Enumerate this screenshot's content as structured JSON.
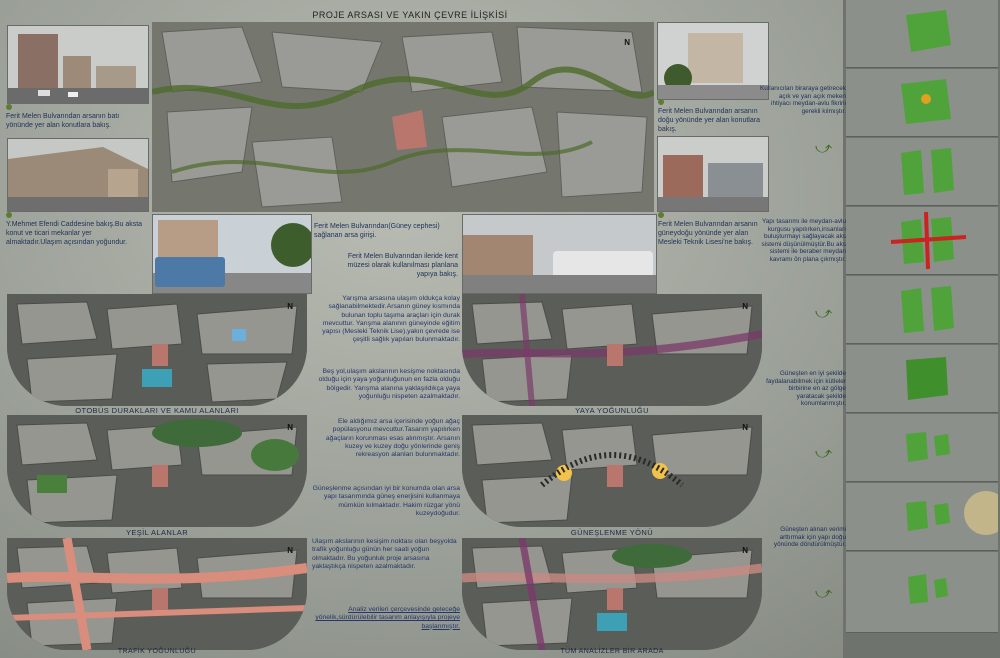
{
  "page_title": "PROJE ARSASI VE YAKIN ÇEVRE İLİŞKİSİ",
  "north": "N",
  "captions": {
    "c1": "Ferit Melen Bulvarından arsanın batı yönünde yer alan konutlara bakış.",
    "c2": "Y.Mehmet Efendi Caddesine bakış.Bu aksta konut ve ticari mekanlar yer almaktadır.Ulaşım açısından yoğundur.",
    "c3": "Ferit Melen Bulvarından arsanın doğu yönünde yer alan konutlara bakış.",
    "c4": "Ferit Melen Bulvarından(Güney cephesi) sağlanan arsa girişi.",
    "c5": "Ferit Melen Bulvarından ileride kent müzesi olarak kullanılması planlana yapıya bakış.",
    "c6": "Ferit Melen Bulvarından arsanın güneydoğu yönünde yer alan Mesleki Teknik Lisesi'ne bakış."
  },
  "map_labels": {
    "m1": "OTOBÜS DURAKLARI VE KAMU ALANLARI",
    "m2": "YAYA YOĞUNLUĞU",
    "m3": "YEŞİL ALANLAR",
    "m4": "GÜNEŞLENME YÖNÜ",
    "m5": "TRAFİK YOĞUNLUĞU",
    "m6": "TÜM ANALİZLER BİR ARADA"
  },
  "analysis_texts": {
    "t1": "Yarışma arsasına ulaşım oldukça kolay sağlanabilmektedir.Arsanın güney kısmında bulunan toplu taşıma araçları için durak mevcuttur. Yarışma alanının güneyinde eğitim yapısı (Mesleki Teknik Lise),yakın çevrede ise çeşitli sağlık yapıları bulunmaktadır.",
    "t2": "Beş yol,ulaşım akslarının kesişme noktasında olduğu için yaya yoğunluğunun en fazla olduğu bölgedir. Yarışma alanına yaklaşıldıkça yaya yoğunluğu nispeten azalmaktadır.",
    "t3": "Ele aldığımız arsa içerisinde yoğun ağaç popülasyonu mevcuttur.Tasarım yapılırken ağaçların korunması esas alınmıştır. Arsanın kuzey ve kuzey doğu yönlerinde geniş rekreasyon alanları bulunmaktadır.",
    "t4": "Güneşlenme açısından iyi bir konumda olan arsa yapı tasarımında güneş enerjisini kullanmaya mümkün kılmaktadır. Hakim rüzgar yönü kuzeydoğudur.",
    "t5": "Ulaşım akslarının kesişim noktası olan beşyolda trafik yoğunluğu günün her saati yoğun olmaktadır. Bu yoğunluk proje arsasına yaklaştıkça nispeten azalmaktadır.",
    "t6": "Analiz verileri çerçevesinde geleceğe yönelik,sürdürülebilir tasarım anlayışıyla projeye başlanmıştır."
  },
  "right_texts": {
    "r1": "Kullanıcıları biraraya getirecek açık ve yarı açık meken ihtiyacı meydan-avlu fikrini gerekli kılmıştır.",
    "r2": "Yapı tasarımı ile meydan-avlu kurgusu yapılırken,insanları buluşturmayı sağlayacak aks sistemi düşünülmüştür.Bu aks sistemi ile beraber meydan kavramı ön plana çıkmıştır.",
    "r3": "Güneşten en iyi şekilde faydalanabilmek için kütleler birbirine en az gölge yaratacak şekilde konumlanmıştır.",
    "r4": "Güneşten alınan verimi arttırmak için yapı doğu yönünde döndürülmüştür."
  },
  "colors": {
    "green_mass": "#4fa33a",
    "map_bg": "#5a5c58",
    "text_blue": "#26366a"
  }
}
